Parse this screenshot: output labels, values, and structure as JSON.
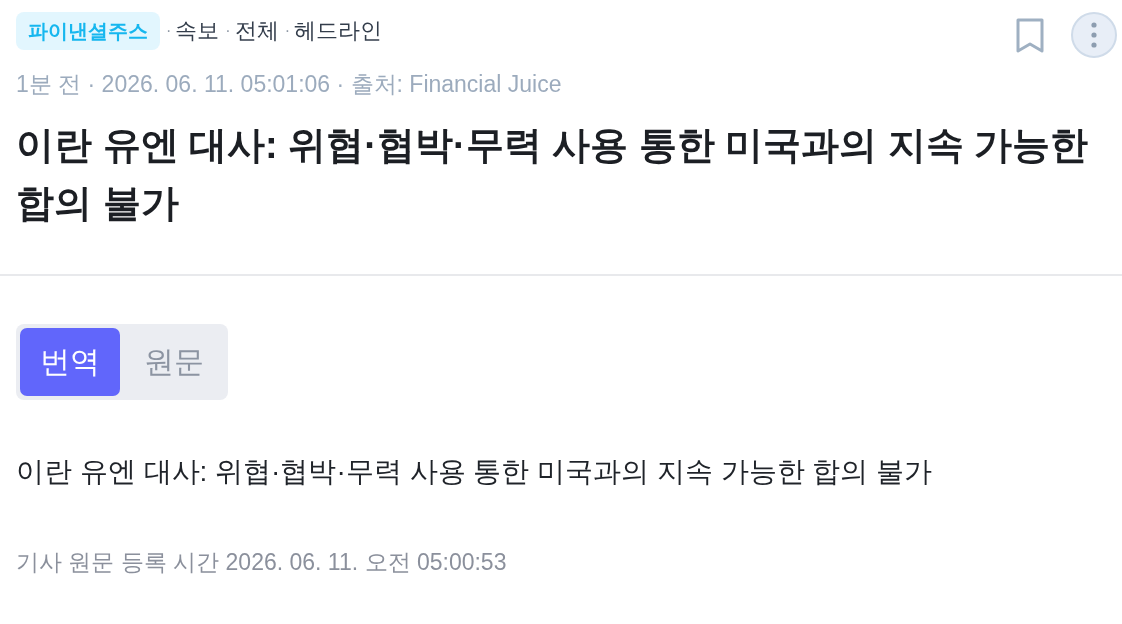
{
  "header": {
    "source_badge": "파이낸셜주스",
    "categories": [
      {
        "separator": "·",
        "label": "속보"
      },
      {
        "separator": "·",
        "label": "전체"
      },
      {
        "separator": "·",
        "label": "헤드라인"
      }
    ],
    "bookmarked": false
  },
  "meta": "1분 전 · 2026. 06. 11. 05:01:06 · 출처: Financial Juice",
  "title": "이란 유엔 대사: 위협·협박·무력 사용 통한 미국과의 지속 가능한 합의 불가",
  "view_tabs": [
    {
      "label": "번역",
      "selected": true
    },
    {
      "label": "원문",
      "selected": false
    }
  ],
  "body": "이란 유엔 대사: 위협·협박·무력 사용 통한 미국과의 지속 가능한 합의 불가",
  "footer": "기사 원문 등록 시간 2026. 06. 11. 오전 05:00:53"
}
